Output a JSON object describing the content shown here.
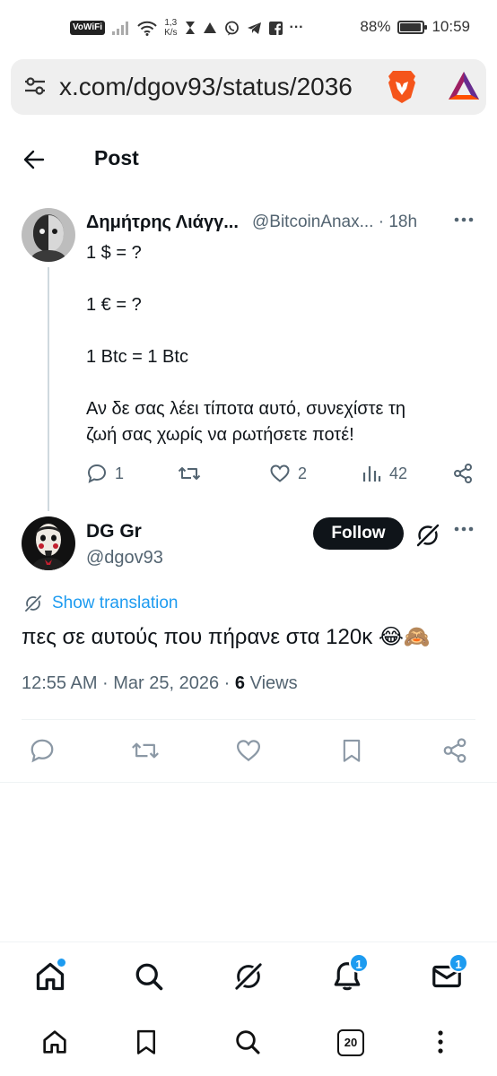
{
  "status_bar": {
    "vowifi": "VoWiFi",
    "net_speed_value": "1,3",
    "net_speed_unit": "K/s",
    "battery": "88%",
    "battery_level": 0.88,
    "time": "10:59"
  },
  "browser": {
    "url": "x.com/dgov93/status/2036",
    "tab_count": "20"
  },
  "header": {
    "title": "Post"
  },
  "quoted_tweet": {
    "author_name": "Δημήτρης Λιάγγ...",
    "author_handle": "@BitcoinAnax...",
    "time_ago": "· 18h",
    "lines": [
      "1 $ = ?",
      "",
      "1 € = ?",
      "",
      "1 Btc = 1 Btc",
      "",
      "Αν δε σας λέει τίποτα αυτό, συνεχίστε τη",
      "ζωή σας χωρίς να ρωτήσετε ποτέ!"
    ],
    "replies": "1",
    "retweets": "",
    "likes": "2",
    "views": "42"
  },
  "main_tweet": {
    "author_name": "DG Gr",
    "author_handle": "@dgov93",
    "follow_label": "Follow",
    "translate_label": "Show translation",
    "text": "πες σε αυτούς που πήρανε στα 120κ 😂🙈",
    "time": "12:55 AM · Mar 25, 2026 · ",
    "views_count": "6",
    "views_label": " Views"
  },
  "bottom_nav": {
    "notifications_badge": "1",
    "messages_badge": "1"
  },
  "colors": {
    "accent": "#1d9bf0",
    "text_primary": "#0f1419",
    "text_secondary": "#536471",
    "divider": "#eff3f4"
  }
}
